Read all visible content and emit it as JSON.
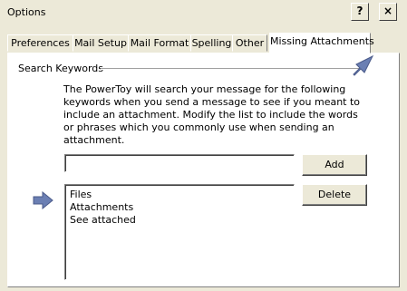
{
  "window": {
    "title": "Options",
    "help_glyph": "?",
    "close_glyph": "×"
  },
  "tabs": [
    {
      "label": "Preferences",
      "active": false
    },
    {
      "label": "Mail Setup",
      "active": false
    },
    {
      "label": "Mail Format",
      "active": false
    },
    {
      "label": "Spelling",
      "active": false
    },
    {
      "label": "Other",
      "active": false
    },
    {
      "label": "Missing Attachments",
      "active": true
    }
  ],
  "panel": {
    "group_label": "Search Keywords",
    "description": "The PowerToy will search your message for the following keywords when you send a message to see if you meant to include an attachment. Modify the list to include the words or phrases which you commonly use when sending an attachment.",
    "keyword_input": {
      "value": "",
      "placeholder": ""
    },
    "add_label": "Add",
    "delete_label": "Delete",
    "keywords": [
      "Files",
      "Attachments",
      "See attached"
    ]
  },
  "colors": {
    "window_bg": "#ece9d8",
    "arrow": "#6b7fb3"
  },
  "icons": {
    "callout_arrow": "pointer-arrow-icon"
  }
}
